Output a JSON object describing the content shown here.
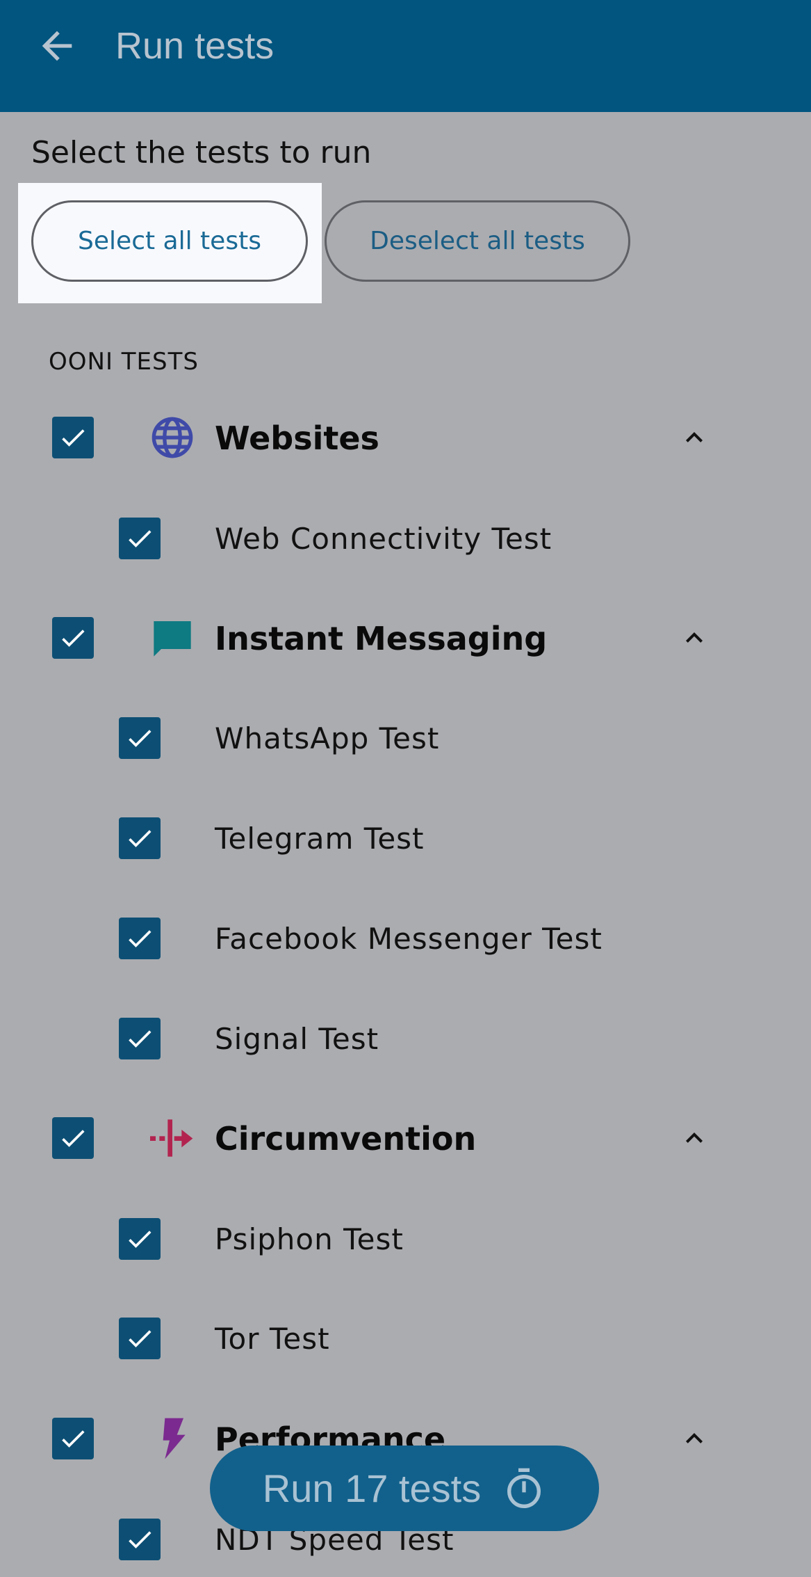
{
  "appbar": {
    "title": "Run tests",
    "back_icon": "arrow-back-icon"
  },
  "subtitle": "Select the tests to run",
  "buttons": {
    "select_all": "Select all tests",
    "deselect_all": "Deselect all tests"
  },
  "section": {
    "title": "OONI TESTS"
  },
  "groups": [
    {
      "label": "Websites",
      "icon": "globe-icon",
      "checked": true,
      "expanded": true,
      "tests": [
        {
          "label": "Web Connectivity Test",
          "checked": true
        }
      ]
    },
    {
      "label": "Instant Messaging",
      "icon": "chat-bubble-icon",
      "checked": true,
      "expanded": true,
      "tests": [
        {
          "label": "WhatsApp Test",
          "checked": true
        },
        {
          "label": "Telegram Test",
          "checked": true
        },
        {
          "label": "Facebook Messenger Test",
          "checked": true
        },
        {
          "label": "Signal Test",
          "checked": true
        }
      ]
    },
    {
      "label": "Circumvention",
      "icon": "circumvention-icon",
      "checked": true,
      "expanded": true,
      "tests": [
        {
          "label": "Psiphon Test",
          "checked": true
        },
        {
          "label": "Tor Test",
          "checked": true
        }
      ]
    },
    {
      "label": "Performance",
      "icon": "lightning-icon",
      "checked": true,
      "expanded": true,
      "tests": [
        {
          "label": "NDT Speed Test",
          "checked": true
        }
      ]
    }
  ],
  "run_button": {
    "label": "Run 17 tests",
    "icon": "timer-icon"
  },
  "colors": {
    "appbar": "#01557f",
    "checkbox": "#0d4f74",
    "globe": "#3f4aa8",
    "chat": "#0e7a82",
    "circumvention": "#b2244f",
    "lightning": "#7b2a8f",
    "run_button": "#12618c"
  }
}
